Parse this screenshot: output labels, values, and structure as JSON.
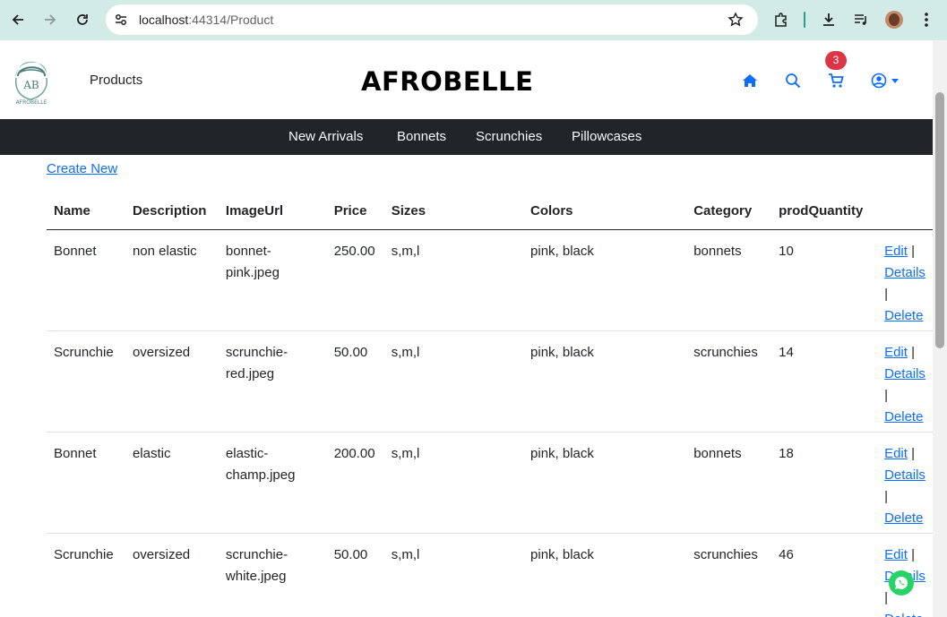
{
  "browser": {
    "url_host": "localhost",
    "url_rest": ":44314/Product"
  },
  "header": {
    "logo_text_top": "AB",
    "logo_text_bottom": "AFROBELLE",
    "products_label": "Products",
    "brand": "AFROBELLE",
    "cart_count": "3"
  },
  "categories": [
    "New Arrivals",
    "Bonnets",
    "Scrunchies",
    "Pillowcases"
  ],
  "create_new": "Create New",
  "table": {
    "headers": [
      "Name",
      "Description",
      "ImageUrl",
      "Price",
      "Sizes",
      "Colors",
      "Category",
      "prodQuantity"
    ],
    "rows": [
      {
        "name": "Bonnet",
        "description": "non elastic",
        "image_url_1": "bonnet-",
        "image_url_2": "pink.jpeg",
        "price": "250.00",
        "sizes": "s,m,l",
        "colors": "pink, black",
        "category": "bonnets",
        "quantity": "10"
      },
      {
        "name": "Scrunchie",
        "description": "oversized",
        "image_url_1": "scrunchie-",
        "image_url_2": "red.jpeg",
        "price": "50.00",
        "sizes": "s,m,l",
        "colors": "pink, black",
        "category": "scrunchies",
        "quantity": "14"
      },
      {
        "name": "Bonnet",
        "description": "elastic",
        "image_url_1": "elastic-",
        "image_url_2": "champ.jpeg",
        "price": "200.00",
        "sizes": "s,m,l",
        "colors": "pink, black",
        "category": "bonnets",
        "quantity": "18"
      },
      {
        "name": "Scrunchie",
        "description": "oversized",
        "image_url_1": "scrunchie-",
        "image_url_2": "white.jpeg",
        "price": "50.00",
        "sizes": "s,m,l",
        "colors": "pink, black",
        "category": "scrunchies",
        "quantity": "46"
      }
    ],
    "actions": {
      "edit": "Edit",
      "details": "Details",
      "delete": "Delete",
      "separator": "|"
    }
  },
  "colors": {
    "chrome_bg": "#d3ebe6",
    "nav_dark": "#212529",
    "link": "#0d6efd",
    "badge": "#dc3545",
    "whatsapp": "#25d366"
  }
}
